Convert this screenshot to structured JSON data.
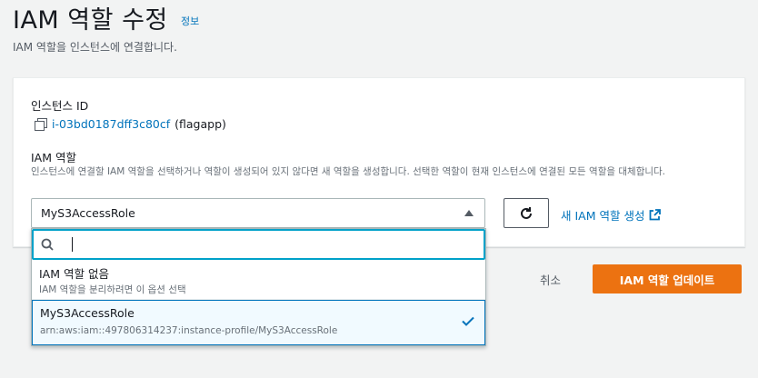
{
  "header": {
    "title": "IAM 역할 수정",
    "info_link": "정보",
    "description": "IAM 역할을 인스턴스에 연결합니다."
  },
  "instance": {
    "label": "인스턴스 ID",
    "id": "i-03bd0187dff3c80cf",
    "name": "(flagapp)"
  },
  "iam_role": {
    "label": "IAM 역할",
    "description": "인스턴스에 연결할 IAM 역할을 선택하거나 역할이 생성되어 있지 않다면 새 역할을 생성합니다. 선택한 역할이 현재 인스턴스에 연결된 모든 역할을 대체합니다.",
    "selected_value": "MyS3AccessRole",
    "create_link": "새 IAM 역할 생성"
  },
  "dropdown": {
    "search_value": "",
    "options": [
      {
        "title": "IAM 역할 없음",
        "subtitle": "IAM 역할을 분리하려면 이 옵션 선택"
      },
      {
        "title": "MyS3AccessRole",
        "subtitle": "arn:aws:iam::497806314237:instance-profile/MyS3AccessRole"
      }
    ]
  },
  "actions": {
    "cancel": "취소",
    "update": "IAM 역할 업데이트"
  },
  "colors": {
    "accent": "#ec7211",
    "link": "#0073bb",
    "focus": "#00a1c9"
  },
  "icons": [
    "copy-icon",
    "caret-up-icon",
    "refresh-icon",
    "external-link-icon",
    "search-icon",
    "check-icon"
  ]
}
